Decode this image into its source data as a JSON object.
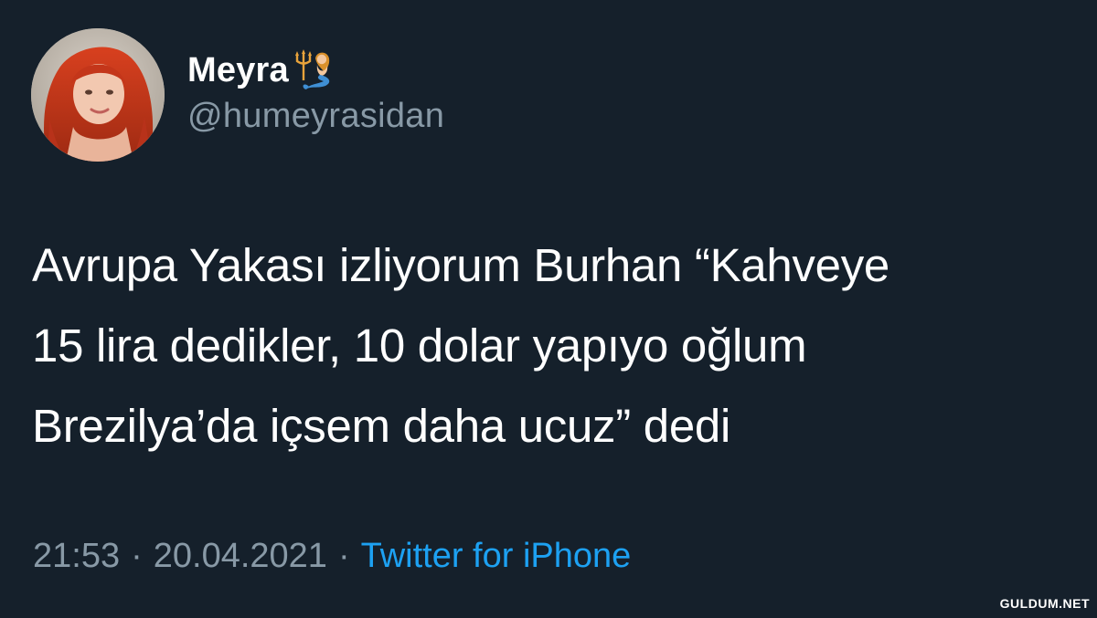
{
  "tweet": {
    "display_name": "Meyra",
    "display_name_emoji": "mermaid-icon",
    "handle": "@humeyrasidan",
    "text_lines": [
      "Avrupa Yakası izliyorum Burhan “Kahveye",
      "15 lira dedikler, 10 dolar yapıyo oğlum",
      "Brezilya’da içsem daha ucuz” dedi"
    ],
    "time": "21:53",
    "separator": "·",
    "date": "20.04.2021",
    "source": "Twitter for iPhone"
  },
  "watermark": "GULDUM.NET",
  "colors": {
    "background": "#15202b",
    "primary_text": "#ffffff",
    "secondary_text": "#8899a6",
    "accent": "#1da1f2"
  }
}
